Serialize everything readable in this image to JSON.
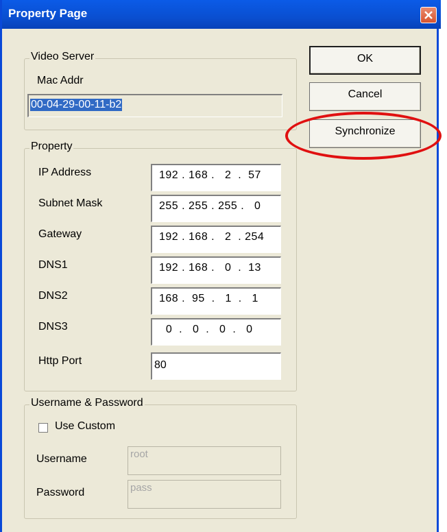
{
  "window": {
    "title": "Property Page"
  },
  "video_server": {
    "group_label": "Video Server",
    "mac_label": "Mac Addr",
    "mac_value": "00-04-29-00-11-b2"
  },
  "property": {
    "group_label": "Property",
    "rows": [
      {
        "label": "IP Address",
        "value": "192 . 168 .   2  .  57"
      },
      {
        "label": "Subnet Mask",
        "value": "255 . 255 . 255 .   0"
      },
      {
        "label": "Gateway",
        "value": "192 . 168 .   2  . 254"
      },
      {
        "label": "DNS1",
        "value": "192 . 168 .   0  .  13"
      },
      {
        "label": "DNS2",
        "value": "168 .  95  .   1  .   1"
      },
      {
        "label": "DNS3",
        "value": "  0  .   0  .   0  .   0"
      }
    ],
    "http_port_label": "Http Port",
    "http_port_value": "80"
  },
  "credentials": {
    "group_label": "Username & Password",
    "use_custom_label": "Use Custom",
    "use_custom_checked": false,
    "username_label": "Username",
    "username_value": "root",
    "password_label": "Password",
    "password_value": "pass"
  },
  "buttons": {
    "ok": "OK",
    "cancel": "Cancel",
    "synchronize": "Synchronize"
  },
  "colors": {
    "title_bar": "#0a4fd1",
    "dialog_bg": "#ece9d8",
    "highlight_circle": "#e01010",
    "selection": "#316ac5"
  },
  "icons": {
    "close": "close-icon"
  }
}
